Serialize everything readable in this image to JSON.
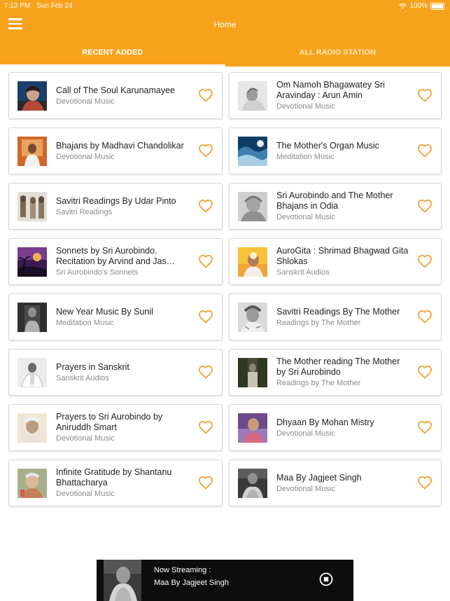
{
  "status_bar": {
    "time": "7:13 PM",
    "date": "Sun Feb 24",
    "battery": "100%"
  },
  "header": {
    "title": "Home",
    "menu_icon": "hamburger-menu-icon"
  },
  "tabs": [
    {
      "label": "RECENT ADDED",
      "active": true
    },
    {
      "label": "ALL RADIO STATION",
      "active": false
    }
  ],
  "colors": {
    "accent": "#f7a21b",
    "heart": "#f0a43a"
  },
  "items": [
    {
      "title": "Call of The Soul Karunamayee",
      "category": "Devotional Music"
    },
    {
      "title": "Om Namoh Bhagawatey Sri Aravinday : Arun Amin",
      "category": "Devotional Music"
    },
    {
      "title": "Bhajans by Madhavi Chandolikar",
      "category": "Devotional Music"
    },
    {
      "title": "The Mother's Organ Music",
      "category": "Meditation Music"
    },
    {
      "title": "Savitri Readings By Udar Pinto",
      "category": "Savitri Readings"
    },
    {
      "title": "Sri Aurobindo and The Mother Bhajans in Odia",
      "category": "Devotional Music"
    },
    {
      "title": "Sonnets by Sri Aurobindo. Recitation by Arvind and Jas…",
      "category": "Sri Aurobindo's Sonnets"
    },
    {
      "title": "AuroGita : Shrimad Bhagwad Gita Shlokas",
      "category": "Sanskrit Audios"
    },
    {
      "title": "New Year Music By Sunil",
      "category": "Meditation Music"
    },
    {
      "title": "Savitri Readings By The Mother",
      "category": "Readings by The Mother"
    },
    {
      "title": "Prayers in Sanskrit",
      "category": "Sanskrit Audios"
    },
    {
      "title": "The Mother reading The Mother by Sri Aurobindo",
      "category": "Readings by The Mother"
    },
    {
      "title": "Prayers to Sri Aurobindo by Aniruddh Smart",
      "category": "Devotional Music"
    },
    {
      "title": "Dhyaan By Mohan Mistry",
      "category": "Devotional Music"
    },
    {
      "title": "Infinite Gratitude by Shantanu Bhattacharya",
      "category": "Devotional Music"
    },
    {
      "title": "Maa By Jagjeet Singh",
      "category": "Devotional Music"
    }
  ],
  "player": {
    "label": "Now Streaming :",
    "track": "Maa By Jagjeet Singh",
    "control_icon": "stop-icon"
  }
}
